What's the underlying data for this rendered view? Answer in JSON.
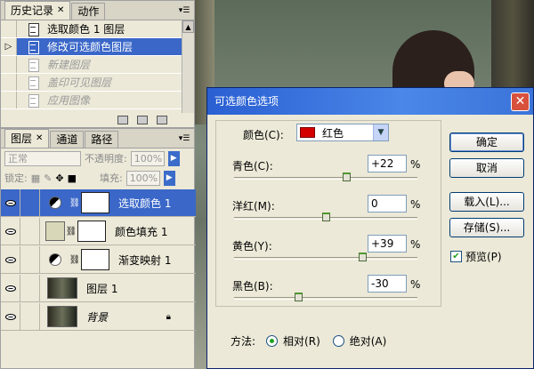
{
  "history_panel": {
    "tabs": [
      {
        "label": "历史记录",
        "active": true
      },
      {
        "label": "动作",
        "active": false
      }
    ],
    "items": [
      {
        "label": "选取颜色 1 图层",
        "state": "normal"
      },
      {
        "label": "修改可选颜色图层",
        "state": "selected"
      },
      {
        "label": "新建图层",
        "state": "dimmed"
      },
      {
        "label": "盖印可见图层",
        "state": "dimmed"
      },
      {
        "label": "应用图像",
        "state": "dimmed"
      }
    ]
  },
  "layers_panel": {
    "tabs": [
      {
        "label": "图层"
      },
      {
        "label": "通道"
      },
      {
        "label": "路径"
      }
    ],
    "blend_mode": "正常",
    "opacity_label": "不透明度:",
    "opacity_value": "100%",
    "lock_label": "锁定:",
    "fill_label": "填充:",
    "fill_value": "100%",
    "layers": [
      {
        "name": "选取颜色 1",
        "type": "adjustment",
        "selected": true
      },
      {
        "name": "颜色填充 1",
        "type": "fill",
        "selected": false
      },
      {
        "name": "渐变映射 1",
        "type": "adjustment",
        "selected": false
      },
      {
        "name": "图层 1",
        "type": "image",
        "selected": false
      },
      {
        "name": "背景",
        "type": "background",
        "selected": false,
        "locked": true
      }
    ]
  },
  "dialog": {
    "title": "可选颜色选项",
    "color_label": "颜色(C):",
    "color_value": "红色",
    "sliders": [
      {
        "label": "青色(C):",
        "value": "+22",
        "unit": "%",
        "fraction": 0.61
      },
      {
        "label": "洋红(M):",
        "value": "0",
        "unit": "%",
        "fraction": 0.5
      },
      {
        "label": "黄色(Y):",
        "value": "+39",
        "unit": "%",
        "fraction": 0.7
      },
      {
        "label": "黑色(B):",
        "value": "-30",
        "unit": "%",
        "fraction": 0.35
      }
    ],
    "buttons": {
      "ok": "确定",
      "cancel": "取消",
      "load": "载入(L)...",
      "save": "存储(S)..."
    },
    "preview_label": "预览(P)",
    "preview_checked": true,
    "method_label": "方法:",
    "methods": [
      {
        "label": "相对(R)",
        "checked": true
      },
      {
        "label": "绝对(A)",
        "checked": false
      }
    ]
  },
  "colors": {
    "selection": "#3a67c8",
    "swatch_red": "#d40000",
    "title_bar": "#2a5fd2"
  }
}
